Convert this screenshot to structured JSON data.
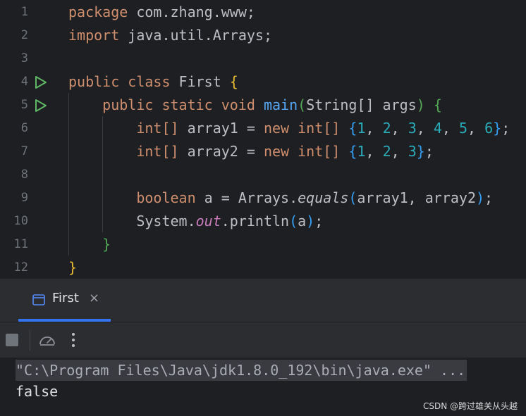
{
  "editor": {
    "line_numbers": [
      "1",
      "2",
      "3",
      "4",
      "5",
      "6",
      "7",
      "8",
      "9",
      "10",
      "11",
      "12"
    ],
    "line1": {
      "kw": "package",
      "rest": " com.zhang.www;"
    },
    "line2": {
      "kw": "import",
      "rest": " java.util.Arrays;"
    },
    "line4": {
      "kw": "public class",
      "name": " First ",
      "brace": "{"
    },
    "line5": {
      "kw": "public static void",
      "fn": "main",
      "p_open": "(",
      "params": "String[] args",
      "p_close": ")",
      "brace": "{"
    },
    "line6": {
      "type": "int[]",
      "decl": " array1 = ",
      "new": "new",
      "type2": " int[] ",
      "open": "{",
      "n1": "1",
      "n2": "2",
      "n3": "3",
      "n4": "4",
      "n5": "5",
      "n6": "6",
      "close": "}",
      "end": ";"
    },
    "line7": {
      "type": "int[]",
      "decl": " array2 = ",
      "new": "new",
      "type2": " int[] ",
      "open": "{",
      "n1": "1",
      "n2": "2",
      "n3": "3",
      "close": "}",
      "end": ";"
    },
    "line9": {
      "kw": "boolean",
      "decl": " a = Arrays.",
      "method": "equals",
      "p_open": "(",
      "args": "array1, array2",
      "p_close": ")",
      "end": ";"
    },
    "line10": {
      "obj": "System.",
      "field": "out",
      "call": ".println",
      "p_open": "(",
      "arg": "a",
      "p_close": ")",
      "end": ";"
    },
    "line11": {
      "brace": "}"
    },
    "line12": {
      "brace": "}"
    },
    "comma": ", "
  },
  "run_panel": {
    "tab_label": "First",
    "close_glyph": "×",
    "more_glyph": "⋮",
    "output_command": "\"C:\\Program Files\\Java\\jdk1.8.0_192\\bin\\java.exe\" ...",
    "output_result": "false"
  },
  "watermark": "CSDN @跨过雄关从头越",
  "icons": [
    "run-gutter-icon",
    "console-tab-icon",
    "close-icon",
    "stop-icon",
    "profiler-gauge-icon",
    "more-options-icon"
  ],
  "colors": {
    "editor_bg": "#1e1f22",
    "panel_bg": "#2b2d30",
    "keyword": "#cf8e6d",
    "number": "#2aacb8",
    "function": "#56a8f5",
    "field": "#c77dbb",
    "tab_accent": "#3574f0",
    "run_icon": "#5fb865"
  }
}
